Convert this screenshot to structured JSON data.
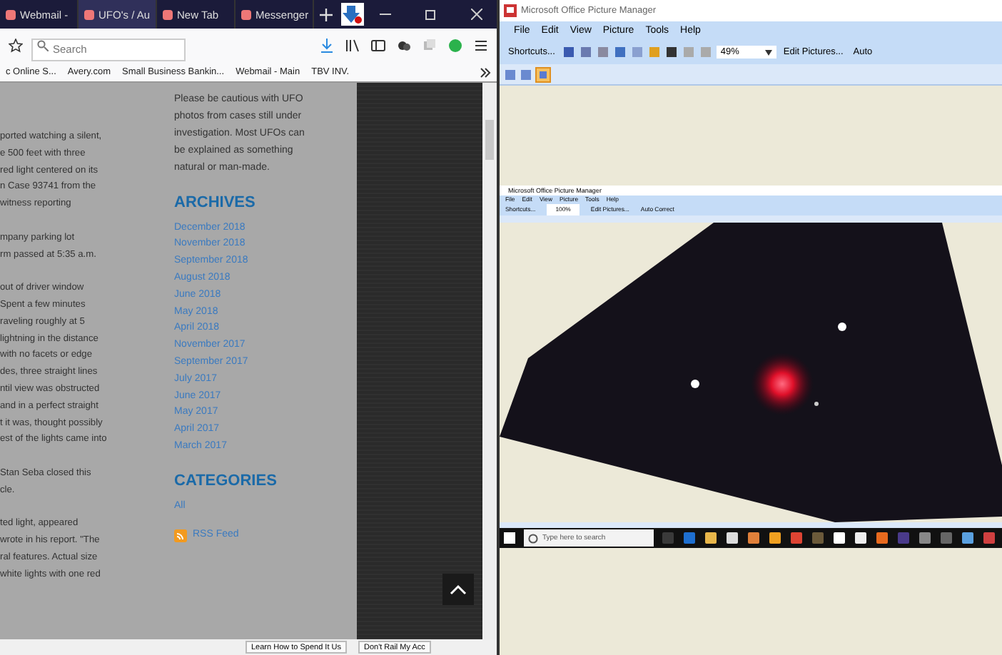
{
  "browser": {
    "tabs": [
      {
        "label": "Webmail -",
        "selected": false
      },
      {
        "label": "UFO's / Au",
        "selected": true
      },
      {
        "label": "New Tab",
        "selected": false
      },
      {
        "label": "Messenger",
        "selected": false
      }
    ],
    "search": {
      "placeholder": "Search"
    },
    "bookmarks": [
      "c Online S...",
      "Avery.com",
      "Small Business Bankin...",
      "Webmail - Main",
      "TBV INV."
    ],
    "article_paragraphs": [
      [
        "ported watching a silent,",
        "e 500 feet with three",
        "red light centered on its",
        "n Case 93741 from the",
        "witness reporting"
      ],
      [
        "mpany parking lot",
        "rm passed at 5:35 a.m."
      ],
      [
        "out of driver window",
        "Spent a few minutes",
        "raveling roughly at 5",
        "lightning in the distance",
        "with no facets or edge",
        "des, three straight lines",
        "ntil view was obstructed",
        "and in a perfect straight",
        "t it was, thought possibly",
        "est of the lights came into"
      ],
      [
        "Stan Seba closed this",
        "cle."
      ],
      [
        "ted light, appeared",
        "wrote in his report. \"The",
        "ral features.  Actual size",
        "white lights with one red"
      ]
    ],
    "sidebar": {
      "intro": "Please be cautious with UFO photos from cases still under investigation. Most UFOs can be explained as something natural or man-made.",
      "archives_heading": "ARCHIVES",
      "archives": [
        "December 2018",
        "November 2018",
        "September 2018",
        "August 2018",
        "June 2018",
        "May 2018",
        "April 2018",
        "November 2017",
        "September 2017",
        "July 2017",
        "June 2017",
        "May 2017",
        "April 2017",
        "March 2017"
      ],
      "categories_heading": "CATEGORIES",
      "categories": [
        "All"
      ],
      "rss": "RSS Feed"
    },
    "bottom_buttons": [
      "Learn How to Spend It Us",
      "Don't Rail My Acc"
    ]
  },
  "picture_manager": {
    "title": "Microsoft Office Picture Manager",
    "menu": [
      "File",
      "Edit",
      "View",
      "Picture",
      "Tools",
      "Help"
    ],
    "shortcuts": "Shortcuts...",
    "zoom": "49%",
    "edit_pictures": "Edit Pictures...",
    "auto": "Auto",
    "inner_screenshot": {
      "title": "Microsoft Office Picture Manager",
      "menu": [
        "File",
        "Edit",
        "View",
        "Picture",
        "Tools",
        "Help"
      ],
      "shortcuts": "Shortcuts...",
      "zoom": "100%",
      "edit_pictures": "Edit Pictures...",
      "auto_correct": "Auto Correct",
      "taskbar_search": "Type here to search"
    }
  }
}
